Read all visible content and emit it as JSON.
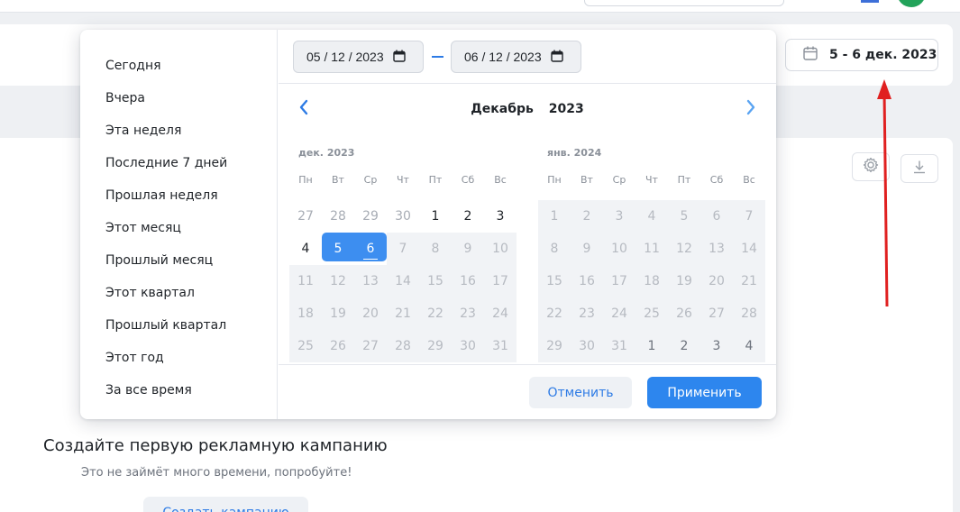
{
  "header": {
    "date_range_label": "5 - 6 дек. 2023"
  },
  "empty_state": {
    "title": "Создайте первую рекламную кампанию",
    "subtitle": "Это не займёт много времени, попробуйте!",
    "create_button": "Создать кампанию"
  },
  "popup": {
    "presets": [
      "Сегодня",
      "Вчера",
      "Эта неделя",
      "Последние 7 дней",
      "Прошлая неделя",
      "Этот месяц",
      "Прошлый месяц",
      "Этот квартал",
      "Прошлый квартал",
      "Этот год",
      "За все время"
    ],
    "start_date": "05 / 12 / 2023",
    "end_date": "06 / 12 / 2023",
    "nav_month": "Декабрь",
    "nav_year": "2023",
    "weekdays": [
      "Пн",
      "Вт",
      "Ср",
      "Чт",
      "Пт",
      "Сб",
      "Вс"
    ],
    "months": [
      {
        "label": "дек. 2023",
        "weeks": [
          [
            "27",
            "28",
            "29",
            "30",
            "1",
            "2",
            "3"
          ],
          [
            "4",
            "5",
            "6",
            "7",
            "8",
            "9",
            "10"
          ],
          [
            "11",
            "12",
            "13",
            "14",
            "15",
            "16",
            "17"
          ],
          [
            "18",
            "19",
            "20",
            "21",
            "22",
            "23",
            "24"
          ],
          [
            "25",
            "26",
            "27",
            "28",
            "29",
            "30",
            "31"
          ]
        ]
      },
      {
        "label": "янв. 2024",
        "weeks": [
          [
            "1",
            "2",
            "3",
            "4",
            "5",
            "6",
            "7"
          ],
          [
            "8",
            "9",
            "10",
            "11",
            "12",
            "13",
            "14"
          ],
          [
            "15",
            "16",
            "17",
            "18",
            "19",
            "20",
            "21"
          ],
          [
            "22",
            "23",
            "24",
            "25",
            "26",
            "27",
            "28"
          ],
          [
            "29",
            "30",
            "31",
            "1",
            "2",
            "3",
            "4"
          ]
        ]
      }
    ],
    "cancel_label": "Отменить",
    "apply_label": "Применить"
  },
  "colors": {
    "accent": "#2d86ee",
    "selection": "#3d8ef0",
    "arrow": "#e02020"
  },
  "icons": [
    "calendar-icon",
    "chevron-left-icon",
    "chevron-right-icon",
    "gear-icon",
    "download-icon"
  ]
}
